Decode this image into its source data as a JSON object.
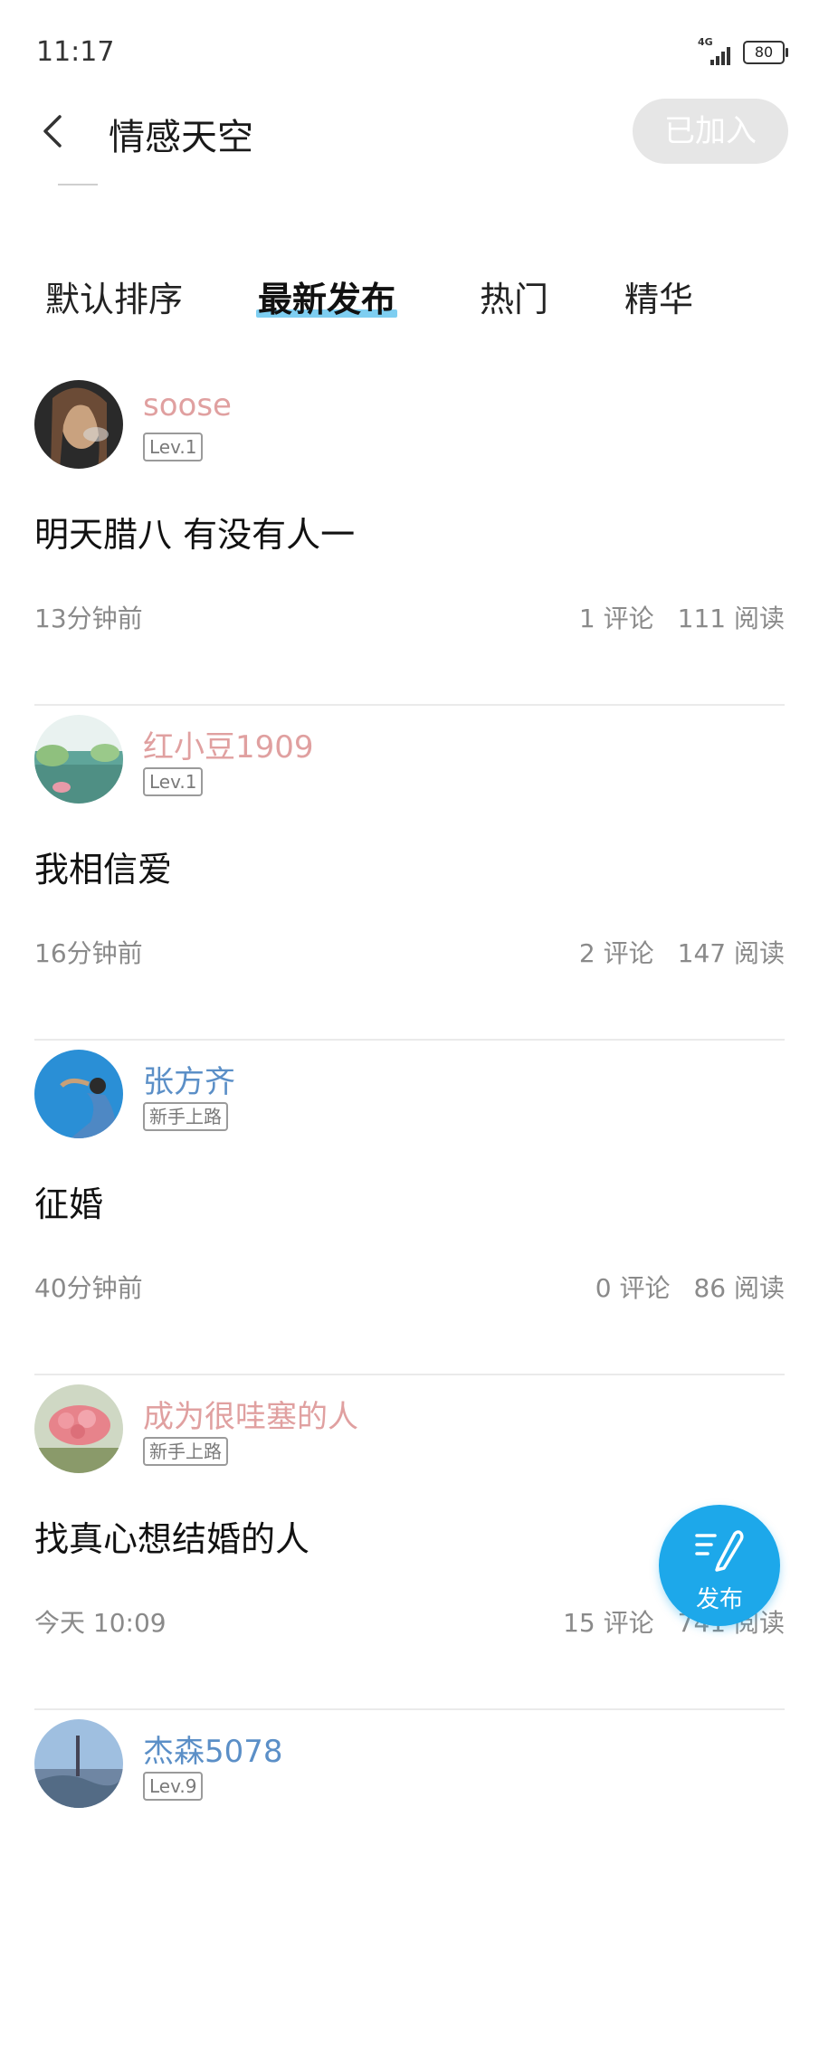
{
  "status_bar": {
    "time": "11:17",
    "network": "4G",
    "battery": "80"
  },
  "header": {
    "title": "情感天空",
    "joined_label": "已加入"
  },
  "tabs": [
    {
      "label": "默认排序",
      "active": false
    },
    {
      "label": "最新发布",
      "active": true
    },
    {
      "label": "热门",
      "active": false
    },
    {
      "label": "精华",
      "active": false
    }
  ],
  "posts": [
    {
      "username": "soose",
      "username_color": "#e0a0a0",
      "level": "Lev.1",
      "content": "明天腊八 有没有人一",
      "time": "13分钟前",
      "comments": "1 评论",
      "reads": "111 阅读"
    },
    {
      "username": "红小豆1909",
      "username_color": "#e0a0a0",
      "level": "Lev.1",
      "content": "我相信爱",
      "time": "16分钟前",
      "comments": "2 评论",
      "reads": "147 阅读"
    },
    {
      "username": "张方齐",
      "username_color": "#5b8fc7",
      "level": "新手上路",
      "content": "征婚",
      "time": "40分钟前",
      "comments": "0 评论",
      "reads": "86 阅读"
    },
    {
      "username": "成为很哇塞的人",
      "username_color": "#e0a0a0",
      "level": "新手上路",
      "content": "找真心想结婚的人",
      "time": "今天 10:09",
      "comments": "15 评论",
      "reads": "741 阅读"
    },
    {
      "username": "杰森5078",
      "username_color": "#5b8fc7",
      "level": "Lev.9"
    }
  ],
  "fab": {
    "label": "发布"
  },
  "colors": {
    "accent": "#1da8ea",
    "tab_underline": "#67c6ef",
    "joined_button_bg": "#e6e6e6"
  },
  "icons": [
    "back-arrow-icon",
    "signal-icon",
    "battery-icon",
    "compose-icon"
  ]
}
